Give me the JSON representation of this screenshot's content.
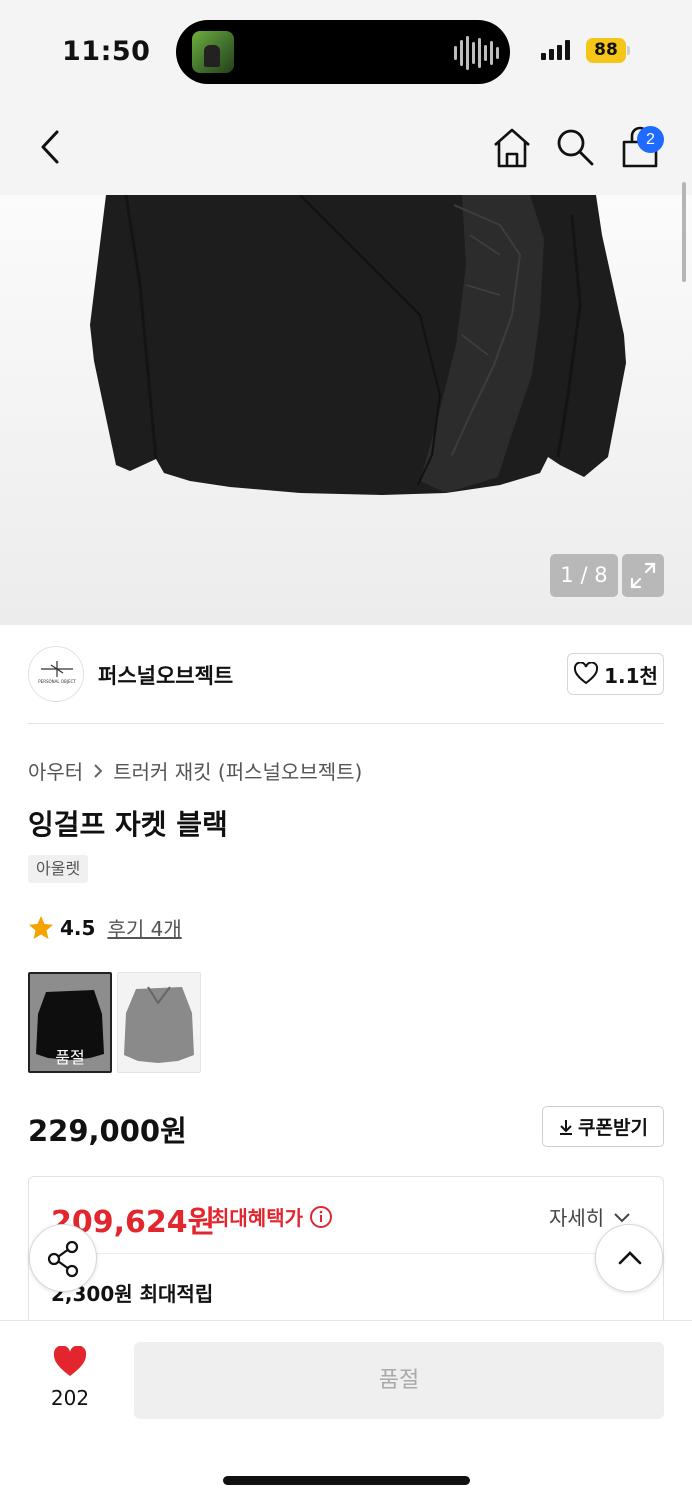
{
  "status_bar": {
    "time": "11:50",
    "battery": "88"
  },
  "nav": {
    "cart_count": "2"
  },
  "gallery": {
    "counter": "1 / 8"
  },
  "brand": {
    "name": "퍼스널오브젝트",
    "logo_text": "PERSONAL OBJECT",
    "likes": "1.1천"
  },
  "breadcrumb": {
    "category": "아우터",
    "subcategory": "트러커 재킷 (퍼스널오브젝트)"
  },
  "product": {
    "title": "잉걸프 자켓 블랙",
    "tag": "아울렛",
    "rating": "4.5",
    "reviews": "후기 4개",
    "thumb_soldout": "품절",
    "price": "229,000원",
    "coupon_label": "쿠폰받기"
  },
  "benefit": {
    "max_price": "209,624원",
    "max_label": "최대혜택가",
    "detail_label": "자세히",
    "points": "2,300원 최대적립"
  },
  "bottom_bar": {
    "like_count": "202",
    "buy_label": "품절"
  },
  "colors": {
    "accent_red": "#e3262e",
    "badge_blue": "#1f6bff",
    "star": "#f5a300"
  }
}
